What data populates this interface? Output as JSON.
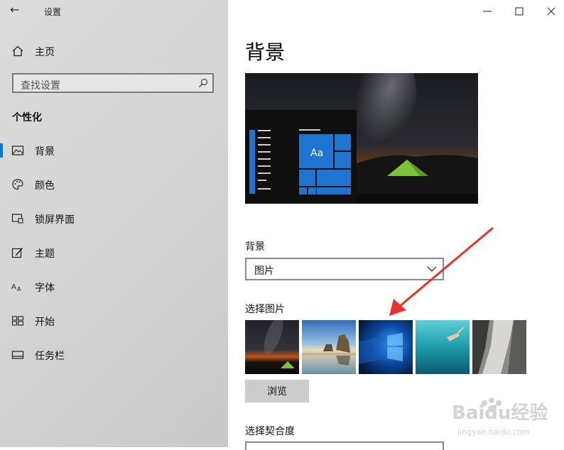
{
  "window": {
    "title": "设置"
  },
  "sidebar": {
    "home_label": "主页",
    "search_placeholder": "查找设置",
    "section_title": "个性化",
    "items": [
      {
        "label": "背景",
        "icon": "picture-icon",
        "active": true
      },
      {
        "label": "颜色",
        "icon": "palette-icon"
      },
      {
        "label": "锁屏界面",
        "icon": "lock-screen-icon"
      },
      {
        "label": "主题",
        "icon": "theme-brush-icon"
      },
      {
        "label": "字体",
        "icon": "font-icon"
      },
      {
        "label": "开始",
        "icon": "start-tiles-icon"
      },
      {
        "label": "任务栏",
        "icon": "taskbar-icon"
      }
    ]
  },
  "main": {
    "title": "背景",
    "preview": {
      "tile_text": "Aa"
    },
    "background_label": "背景",
    "background_value": "图片",
    "choose_picture_label": "选择图片",
    "thumbnails": [
      "night-sky-tent",
      "rock-beach",
      "windows-hero",
      "underwater-swimmer",
      "rock-cliff"
    ],
    "browse_label": "浏览",
    "fit_label": "选择契合度"
  },
  "watermark": {
    "brand": "Baidu经验",
    "url": "jingyan.baidu.com"
  },
  "colors": {
    "accent": "#0078d7",
    "annotation_arrow": "#e8322a"
  }
}
